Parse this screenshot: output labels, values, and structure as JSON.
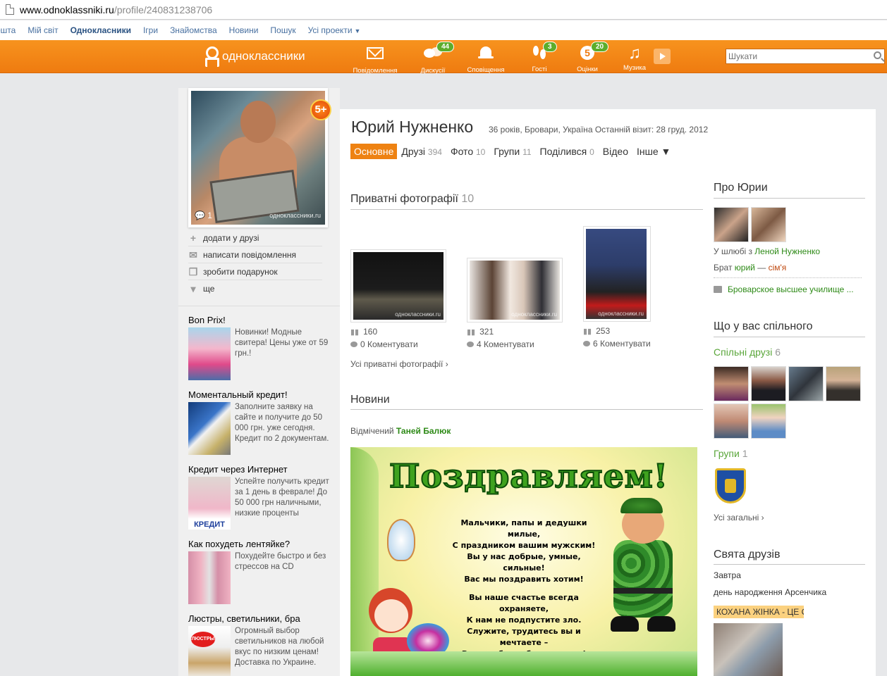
{
  "browser": {
    "url_host": "www.odnoklassniki.ru",
    "url_path": "/profile/240831238706"
  },
  "toplinks": [
    {
      "label": "ошта"
    },
    {
      "label": "Мій світ"
    },
    {
      "label": "Однокласники",
      "active": true
    },
    {
      "label": "Ігри"
    },
    {
      "label": "Знайомства"
    },
    {
      "label": "Новини"
    },
    {
      "label": "Пошук"
    },
    {
      "label": "Усі проекти"
    }
  ],
  "nav": {
    "logo": "одноклассники",
    "items": [
      {
        "label": "Повідомлення",
        "icon": "envelope-icon"
      },
      {
        "label": "Дискусії",
        "icon": "chat-icon",
        "badge": "44"
      },
      {
        "label": "Сповіщення",
        "icon": "bell-icon"
      },
      {
        "label": "Гості",
        "icon": "footprints-icon",
        "badge": "3"
      },
      {
        "label": "Оцінки",
        "icon": "rating-five-icon",
        "badge": "20",
        "glyph": "5"
      },
      {
        "label": "Музика",
        "icon": "music-note-icon",
        "glyph": "♫"
      }
    ],
    "search_placeholder": "Шукати"
  },
  "profile": {
    "name": "Юрий Нужненко",
    "meta": "36 років, Бровари, Україна  Останній візит: 28 груд. 2012",
    "photo_badge": "5+",
    "photo_comments": "1",
    "watermark": "одноклассники.ru"
  },
  "actions": [
    {
      "label": "додати у друзі",
      "glyph": "+"
    },
    {
      "label": "написати повідомлення",
      "glyph": "✉"
    },
    {
      "label": "зробити подарунок",
      "glyph": "❒"
    },
    {
      "label": "ще",
      "glyph": "▾"
    }
  ],
  "ads": [
    {
      "title": "Bon Prix!",
      "text": "Новинки! Модные свитера! Цены уже от 59 грн.!"
    },
    {
      "title": "Моментальный кредит!",
      "text": "Заполните заявку на сайте и получите до 50 000 грн. уже сегодня. Кредит по 2 документам."
    },
    {
      "title": "Кредит через Интернет",
      "text": "Успейте получить кредит за 1 день в феврале! До 50 000 грн наличными, низкие проценты",
      "img_label": "КРЕДИТ"
    },
    {
      "title": "Как похудеть лентяйке?",
      "text": "Похудейте быстро и без стрессов на CD"
    },
    {
      "title": "Люстры, светильники, бра",
      "text": "Огромный выбор светильников на любой вкус по низким ценам! Доставка по Украине.",
      "img_label": "ЛЮСТРЫ"
    }
  ],
  "tabs": [
    {
      "label": "Основне",
      "active": true
    },
    {
      "label": "Друзі",
      "count": "394"
    },
    {
      "label": "Фото",
      "count": "10"
    },
    {
      "label": "Групи",
      "count": "11"
    },
    {
      "label": "Поділився",
      "count": "0"
    },
    {
      "label": "Відео"
    },
    {
      "label": "Інше ▼"
    }
  ],
  "photos_section": {
    "title": "Приватні фотографії",
    "count": "10",
    "items": [
      {
        "views": "160",
        "comments": "0 Коментувати"
      },
      {
        "views": "321",
        "comments": "4 Коментувати"
      },
      {
        "views": "253",
        "comments": "6 Коментувати"
      }
    ],
    "all_link": "Усі приватні фотографії ›"
  },
  "news": {
    "title": "Новини",
    "note_prefix": "Відмічений ",
    "note_name": "Таней Балюк",
    "card_headline": "Поздравляем!",
    "card_poem": [
      "Мальчики, папы и дедушки милые,",
      "С праздником вашим мужским!",
      "Вы у нас добрые, умные, сильные!",
      "Вас мы поздравить хотим!"
    ],
    "card_poem2": [
      "Вы наше счастье всегда охраняете,",
      "К нам не подпустите зло.",
      "Служите, трудитесь вы и мечтаете –",
      "Все, чтоб нам было светло!"
    ]
  },
  "about": {
    "title": "Про Юрии",
    "married_prefix": "У шлюбі з ",
    "married_name": "Леной Нужненко",
    "brother_prefix": "Брат ",
    "brother_name": "юрий",
    "brother_sep": " — ",
    "brother_rel": "сім'я",
    "school": "Броварское высшее училище ..."
  },
  "common": {
    "title": "Що у вас спільного",
    "friends_label": "Спільні друзі",
    "friends_count": "6",
    "groups_label": "Групи",
    "groups_count": "1",
    "all_link": "Усі загальні ›"
  },
  "holidays": {
    "title": "Свята друзів",
    "when": "Завтра",
    "event": "день народження Арсенчика",
    "promo": "КОХАНА ЖІНКА - ЦЕ С"
  }
}
